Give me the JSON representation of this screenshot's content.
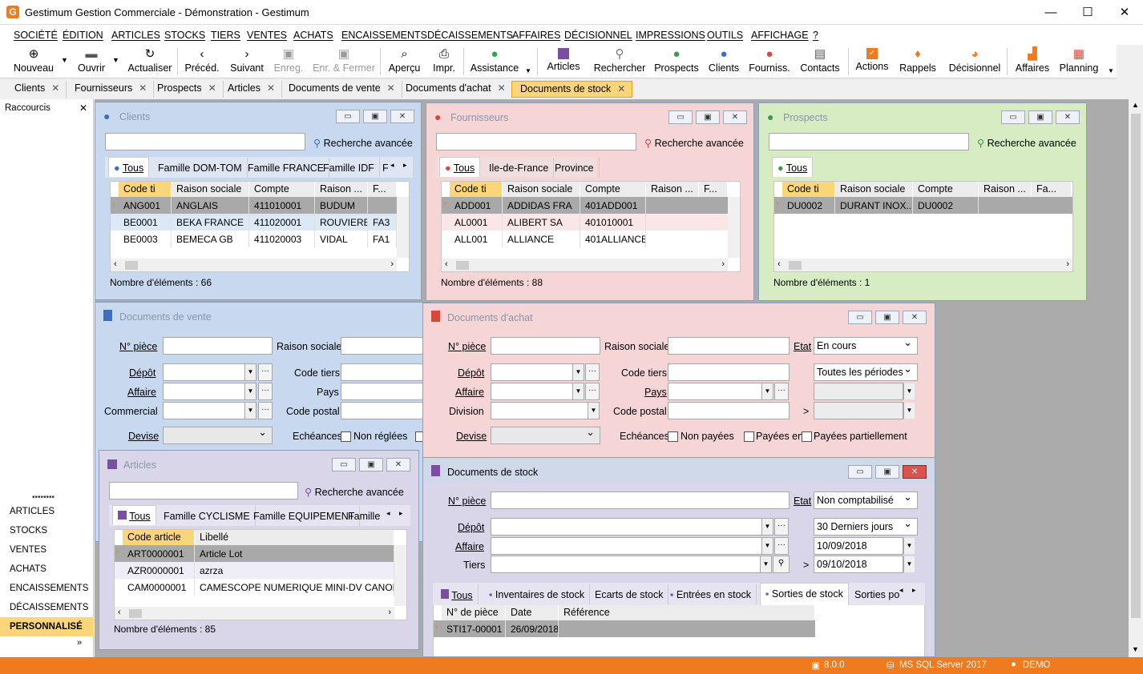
{
  "app": {
    "title": "Gestimum Gestion Commerciale - Démonstration - Gestimum",
    "logo": "G"
  },
  "window_controls": {
    "minimize": "—",
    "maximize": "☐",
    "close": "✕"
  },
  "menu": [
    "SOCIÉTÉ",
    "ÉDITION",
    "ARTICLES",
    "STOCKS",
    "TIERS",
    "VENTES",
    "ACHATS",
    "ENCAISSEMENTS",
    "DÉCAISSEMENTS",
    "AFFAIRES",
    "DÉCISIONNEL",
    "IMPRESSIONS",
    "OUTILS",
    "AFFICHAGE",
    "?"
  ],
  "toolbar": [
    {
      "label": "Nouveau",
      "icon": "plus-icon"
    },
    {
      "label": "Ouvrir",
      "icon": "folder-icon"
    },
    {
      "label": "Actualiser",
      "icon": "refresh-icon"
    },
    {
      "label": "Précéd.",
      "icon": "prev-icon"
    },
    {
      "label": "Suivant",
      "icon": "next-icon"
    },
    {
      "label": "Enreg.",
      "icon": "save-icon"
    },
    {
      "label": "Enr. & Fermer",
      "icon": "save-close-icon"
    },
    {
      "label": "Aperçu",
      "icon": "preview-icon"
    },
    {
      "label": "Impr.",
      "icon": "print-icon"
    },
    {
      "label": "Assistance",
      "icon": "whatsapp-icon"
    },
    {
      "label": "Articles",
      "icon": "articles-icon"
    },
    {
      "label": "Rechercher",
      "icon": "search-person-icon"
    },
    {
      "label": "Prospects",
      "icon": "prospect-icon"
    },
    {
      "label": "Clients",
      "icon": "client-icon"
    },
    {
      "label": "Fourniss.",
      "icon": "supplier-icon"
    },
    {
      "label": "Contacts",
      "icon": "contacts-icon"
    },
    {
      "label": "Actions",
      "icon": "actions-icon"
    },
    {
      "label": "Rappels",
      "icon": "bell-icon"
    },
    {
      "label": "Décisionnel",
      "icon": "pie-icon"
    },
    {
      "label": "Affaires",
      "icon": "chart-icon"
    },
    {
      "label": "Planning",
      "icon": "calendar-icon"
    }
  ],
  "tabs": [
    "Clients",
    "Fournisseurs",
    "Prospects",
    "Articles",
    "Documents de vente",
    "Documents d'achat",
    "Documents de stock"
  ],
  "left_pane": {
    "title": "Raccourcis",
    "items": [
      "ARTICLES",
      "STOCKS",
      "VENTES",
      "ACHATS",
      "ENCAISSEMENTS",
      "DÉCAISSEMENTS",
      "PERSONNALISÉ"
    ]
  },
  "clients": {
    "title": "Clients",
    "adv": "Recherche avancée",
    "tabs": [
      "Tous",
      "Famille DOM-TOM",
      "Famille FRANCE",
      "Famille IDF",
      "F"
    ],
    "headers": [
      "Code ti",
      "Raison sociale",
      "Compte",
      "Raison ...",
      "F..."
    ],
    "rows": [
      [
        "ANG001",
        "ANGLAIS",
        "411010001",
        "BUDUM",
        ""
      ],
      [
        "BE0001",
        "BEKA FRANCE",
        "411020001",
        "ROUVIERE",
        "FA3"
      ],
      [
        "BE0003",
        "BEMECA GB",
        "411020003",
        "VIDAL",
        "FA1"
      ]
    ],
    "count": "Nombre d'éléments : 66"
  },
  "fournisseurs": {
    "title": "Fournisseurs",
    "adv": "Recherche avancée",
    "tabs": [
      "Tous",
      "Ile-de-France",
      "Province"
    ],
    "headers": [
      "Code ti",
      "Raison sociale",
      "Compte",
      "Raison ...",
      "F..."
    ],
    "rows": [
      [
        "ADD001",
        "ADDIDAS FRA",
        "401ADD001",
        "",
        ""
      ],
      [
        "AL0001",
        "ALIBERT SA",
        "401010001",
        "",
        ""
      ],
      [
        "ALL001",
        "ALLIANCE",
        "401ALLIANCE",
        "",
        ""
      ]
    ],
    "count": "Nombre d'éléments : 88"
  },
  "prospects": {
    "title": "Prospects",
    "adv": "Recherche avancée",
    "tabs": [
      "Tous"
    ],
    "headers": [
      "Code ti",
      "Raison sociale",
      "Compte",
      "Raison ...",
      "Fa..."
    ],
    "rows": [
      [
        "DU0002",
        "DURANT INOX...",
        "DU0002",
        "",
        ""
      ]
    ],
    "count": "Nombre d'éléments : 1"
  },
  "docvente": {
    "title": "Documents de vente",
    "labels": {
      "piece": "N° pièce",
      "raison": "Raison sociale",
      "depot": "Dépôt",
      "code_tiers": "Code tiers",
      "affaire": "Affaire",
      "pays": "Pays",
      "commercial": "Commercial",
      "code_postal": "Code postal",
      "devise": "Devise",
      "echeances": "Echéances",
      "non_reglees": "Non réglées"
    }
  },
  "docachat": {
    "title": "Documents d'achat",
    "labels": {
      "piece": "N° pièce",
      "raison": "Raison sociale",
      "etat": "Etat",
      "depot": "Dépôt",
      "code_tiers": "Code tiers",
      "affaire": "Affaire",
      "pays": "Pays",
      "division": "Division",
      "code_postal": "Code postal",
      "devise": "Devise",
      "echeances": "Echéances",
      "non_payees": "Non payées",
      "payees_en": "Payées en",
      "payees_part": "Payées partiellement",
      "gt": ">"
    },
    "etat_value": "En cours",
    "periode_value": "Toutes les périodes"
  },
  "articles": {
    "title": "Articles",
    "adv": "Recherche avancée",
    "tabs": [
      "Tous",
      "Famille CYCLISME",
      "Famille EQUIPEMENT",
      "Famille"
    ],
    "headers": [
      "Code article",
      "Libellé"
    ],
    "rows": [
      [
        "ART0000001",
        "Article Lot"
      ],
      [
        "AZR0000001",
        "azrza"
      ],
      [
        "CAM0000001",
        "CAMESCOPE NUMERIQUE MINI-DV CANON"
      ]
    ],
    "count": "Nombre d'éléments : 85"
  },
  "docstock": {
    "title": "Documents de stock",
    "labels": {
      "piece": "N° pièce",
      "etat": "Etat",
      "depot": "Dépôt",
      "affaire": "Affaire",
      "tiers": "Tiers",
      "gt": ">"
    },
    "etat_value": "Non comptabilisé",
    "periode_value": "30 Derniers jours",
    "date_from": "10/09/2018",
    "date_to": "09/10/2018",
    "tabs": [
      "Tous",
      "Inventaires de stock",
      "Ecarts de stock",
      "Entrées en stock",
      "Sorties de stock",
      "Sorties po"
    ],
    "headers": [
      "N° de pièce",
      "Date",
      "Référence"
    ],
    "rows": [
      [
        "STI17-00001",
        "26/09/2018",
        ""
      ]
    ]
  },
  "status": {
    "version": "8.0.0",
    "db": "MS SQL Server 2017",
    "user": "DEMO"
  },
  "colors": {
    "accent": "#f07b1f",
    "client_bg": "#c7d8ef",
    "supplier_bg": "#f5d5d5",
    "prospect_bg": "#d7ecc3",
    "purple_bg": "#d9d6ea"
  }
}
